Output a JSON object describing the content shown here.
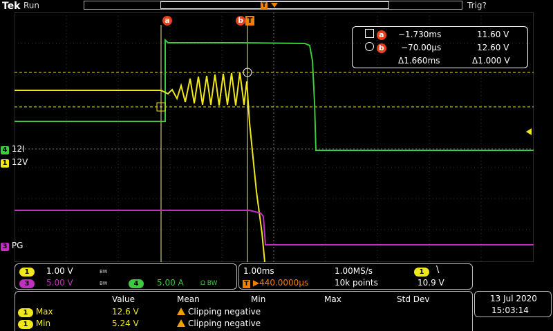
{
  "topbar": {
    "brand": "Tek",
    "run_state": "Run",
    "trig_state": "Trig?",
    "trig_marker": "T"
  },
  "channels": {
    "ch4_marker": {
      "num": "4",
      "label": "12I",
      "color": "#3ec93e"
    },
    "ch1_marker": {
      "num": "1",
      "label": "12V",
      "color": "#f0e81a"
    },
    "ch3_marker": {
      "num": "3",
      "label": "PG",
      "color": "#c030c0"
    }
  },
  "cursor_tags": {
    "a": "a",
    "b": "b",
    "t": "T"
  },
  "cursor_readout": {
    "a_time": "−1.730ms",
    "a_value": "11.60 V",
    "b_time": "−70.00µs",
    "b_value": "12.60 V",
    "delta_time": "Δ1.660ms",
    "delta_value": "Δ1.000 V"
  },
  "vertical": {
    "ch1_num": "1",
    "ch1_scale": "1.00 V",
    "ch1_bw": "BW",
    "ch3_num": "3",
    "ch3_scale": "5.00 V",
    "ch3_bw": "BW",
    "ch4_num": "4",
    "ch4_scale": "5.00 A",
    "ch4_bw": "Ω BW"
  },
  "horizontal": {
    "time_div": "1.00ms",
    "sample_rate": "1.00MS/s",
    "trig_ch": "1",
    "trig_slope": "\\",
    "delay": "▶440.0000µs",
    "record": "10k points",
    "trig_level": "10.9 V"
  },
  "measurements": {
    "headers": [
      "Value",
      "Mean",
      "Min",
      "Max",
      "Std Dev"
    ],
    "rows": [
      {
        "ch": "1",
        "name": "Max",
        "value": "12.6 V",
        "note": "Clipping negative"
      },
      {
        "ch": "1",
        "name": "Min",
        "value": "5.24 V",
        "note": "Clipping negative"
      }
    ]
  },
  "datetime": {
    "date": "13 Jul  2020",
    "time": "15:03:14"
  },
  "colors": {
    "ch1": "#f0e81a",
    "ch3": "#c030c0",
    "ch4": "#3ec93e",
    "cursor": "#e8401a",
    "trigger": "#f08000"
  }
}
